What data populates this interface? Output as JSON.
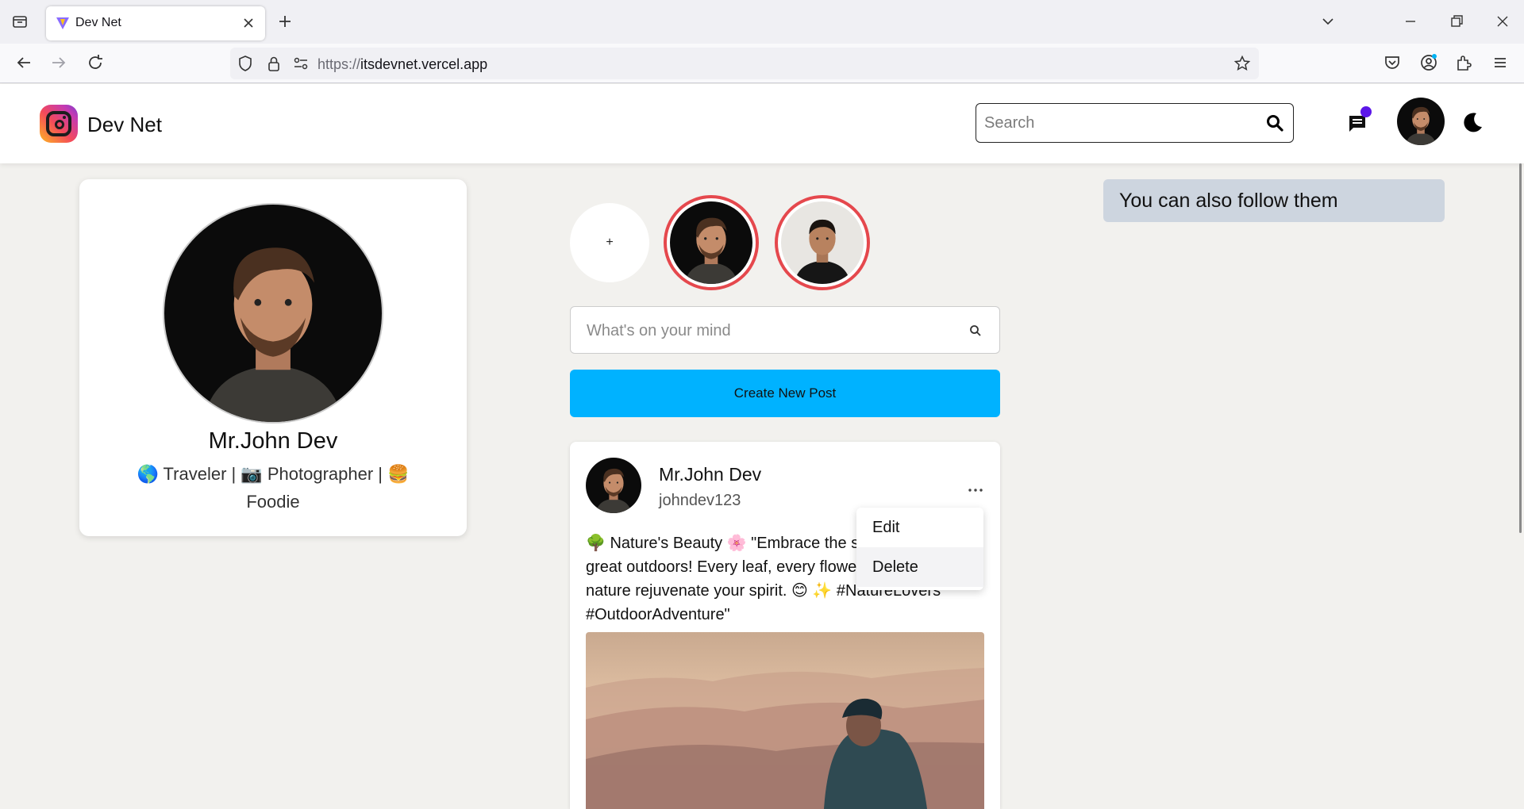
{
  "browser": {
    "tab_title": "Dev Net",
    "url_scheme": "https://",
    "url_host": "itsdevnet.vercel.app"
  },
  "header": {
    "brand": "Dev Net",
    "search_placeholder": "Search",
    "has_unread_messages": true,
    "accent_dot_color": "#5b16e8"
  },
  "profile": {
    "name": "Mr.John Dev",
    "bio": "🌎 Traveler | 📷 Photographer | 🍔 Foodie"
  },
  "stories": {
    "add_label": "+",
    "ring_color": "#e5484d"
  },
  "composer": {
    "placeholder": "What's on your mind",
    "create_label": "Create New Post",
    "button_color": "#00b2ff"
  },
  "post": {
    "author": "Mr.John Dev",
    "handle": "johndev123",
    "text": "🌳 Nature's Beauty 🌸 \"Embrace the serenity of the great outdoors! Every leaf, every flower tells a story. Let nature rejuvenate your spirit. 😊 ✨ #NatureLovers #OutdoorAdventure\"",
    "menu": {
      "edit": "Edit",
      "delete": "Delete"
    }
  },
  "sidebar_right": {
    "suggest_title": "You can also follow them"
  }
}
